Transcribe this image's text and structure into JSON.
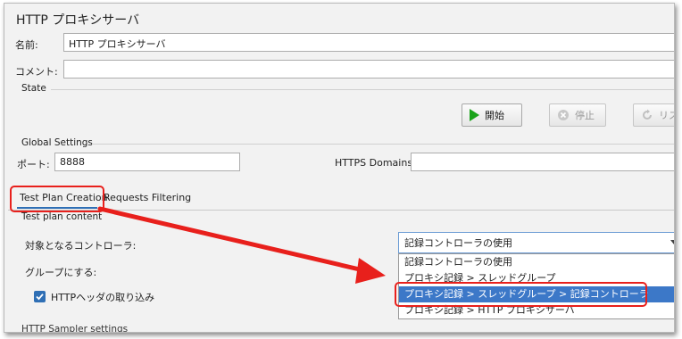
{
  "window": {
    "title": "HTTP プロキシサーバ"
  },
  "name": {
    "label": "名前:",
    "value": "HTTP プロキシサーバ"
  },
  "comment": {
    "label": "コメント:",
    "value": ""
  },
  "state": {
    "label": "State",
    "start_label": "開始",
    "stop_label": "停止",
    "restart_label": "リス"
  },
  "global_settings": {
    "label": "Global Settings",
    "port_label": "ポート:",
    "port_value": "8888",
    "https_domains_label": "HTTPS Domains:",
    "https_domains_value": ""
  },
  "tabs": [
    {
      "label": "Test Plan Creation",
      "active": true
    },
    {
      "label": "Requests Filtering",
      "active": false
    }
  ],
  "test_plan_content": {
    "label": "Test plan content",
    "target_controller_label": "対象となるコントローラ:",
    "target_controller_value": "記録コントローラの使用",
    "grouping_label": "グループにする:",
    "capture_headers_label": "HTTPヘッダの取り込み",
    "capture_headers_checked": true,
    "options": [
      "記録コントローラの使用",
      "プロキシ記録 > スレッドグループ",
      "プロキシ記録 > スレッドグループ > 記録コントローラ",
      "プロキシ記録 > HTTP プロキシサーバ"
    ],
    "selected_option_index": 2
  },
  "bottom_partial_label": "HTTP Sampler settings",
  "colors": {
    "annotation_red": "#e8201c",
    "selection_blue": "#3c78c8",
    "start_green": "#1aa31a"
  }
}
